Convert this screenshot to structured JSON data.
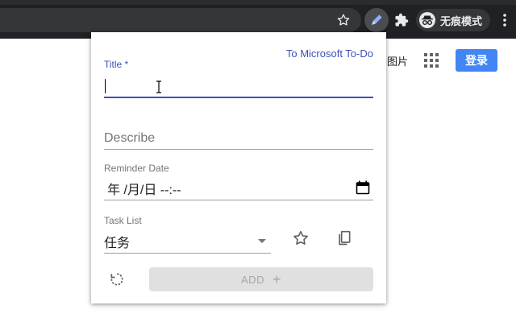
{
  "browser": {
    "incognito_label": "无痕模式",
    "icons": [
      "star-icon",
      "pen-icon",
      "puzzle-icon",
      "incognito-icon",
      "more-vert-icon"
    ]
  },
  "page": {
    "images_link": "图片",
    "login_button": "登录"
  },
  "popup": {
    "ms_todo_link": "To Microsoft To-Do",
    "title_label": "Title *",
    "title_value": "",
    "describe_placeholder": "Describe",
    "reminder_label": "Reminder Date",
    "reminder_value": "年 /月/日 --:--",
    "task_list_label": "Task List",
    "task_list_value": "任务",
    "add_label": "ADD",
    "add_plus": "+"
  },
  "colors": {
    "accent": "#3f51b5",
    "login_blue": "#4285f4",
    "toolbar_dark": "#202124",
    "disabled_bg": "#e0e0e0"
  }
}
